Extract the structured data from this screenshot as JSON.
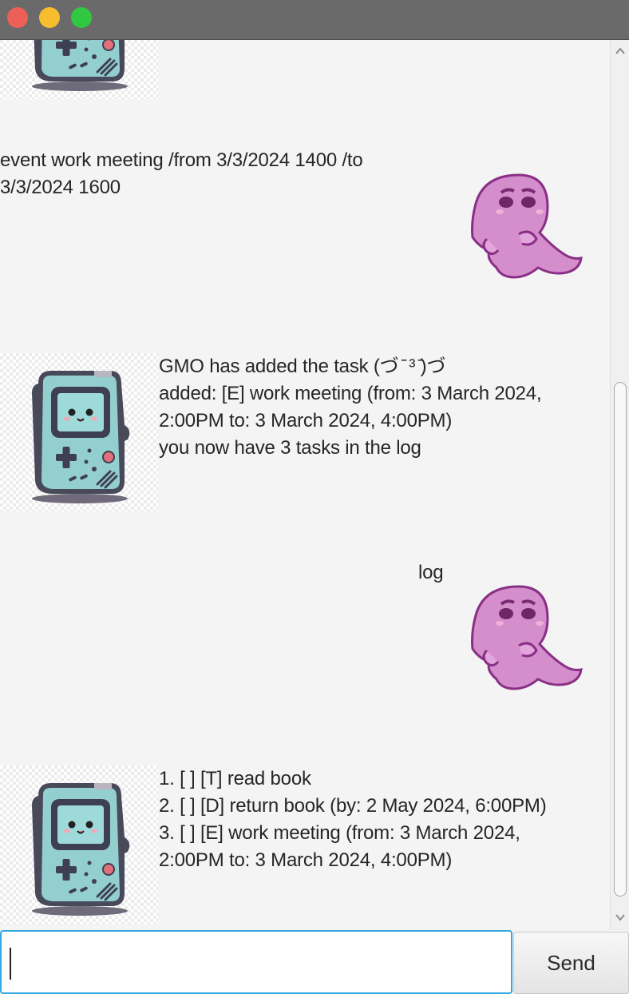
{
  "window": {
    "title_buttons": [
      "close",
      "minimize",
      "maximize"
    ],
    "colors": {
      "close": "#ee5f57",
      "minimize": "#f6be2e",
      "maximize": "#2fc840"
    }
  },
  "messages": [
    {
      "sender": "bot",
      "text": "",
      "avatar": "gameboy-avatar"
    },
    {
      "sender": "user",
      "text": "event work meeting /from 3/3/2024 1400 /to\n3/3/2024 1600",
      "avatar": "ghost-avatar"
    },
    {
      "sender": "bot",
      "text": "GMO has added the task (づ ̄ ³ ̄)づ\nadded: [E] work meeting (from: 3 March 2024,\n2:00PM to: 3 March 2024, 4:00PM)\nyou now have 3 tasks in the log",
      "avatar": "gameboy-avatar"
    },
    {
      "sender": "user",
      "text": "log",
      "avatar": "ghost-avatar"
    },
    {
      "sender": "bot",
      "text": "1. [ ] [T] read book\n2. [ ] [D] return book (by: 2 May 2024, 6:00PM)\n3. [ ] [E] work meeting (from: 3 March 2024,\n2:00PM to: 3 March 2024, 4:00PM)",
      "avatar": "gameboy-avatar"
    }
  ],
  "input": {
    "value": "",
    "placeholder": ""
  },
  "send_button": {
    "label": "Send"
  }
}
